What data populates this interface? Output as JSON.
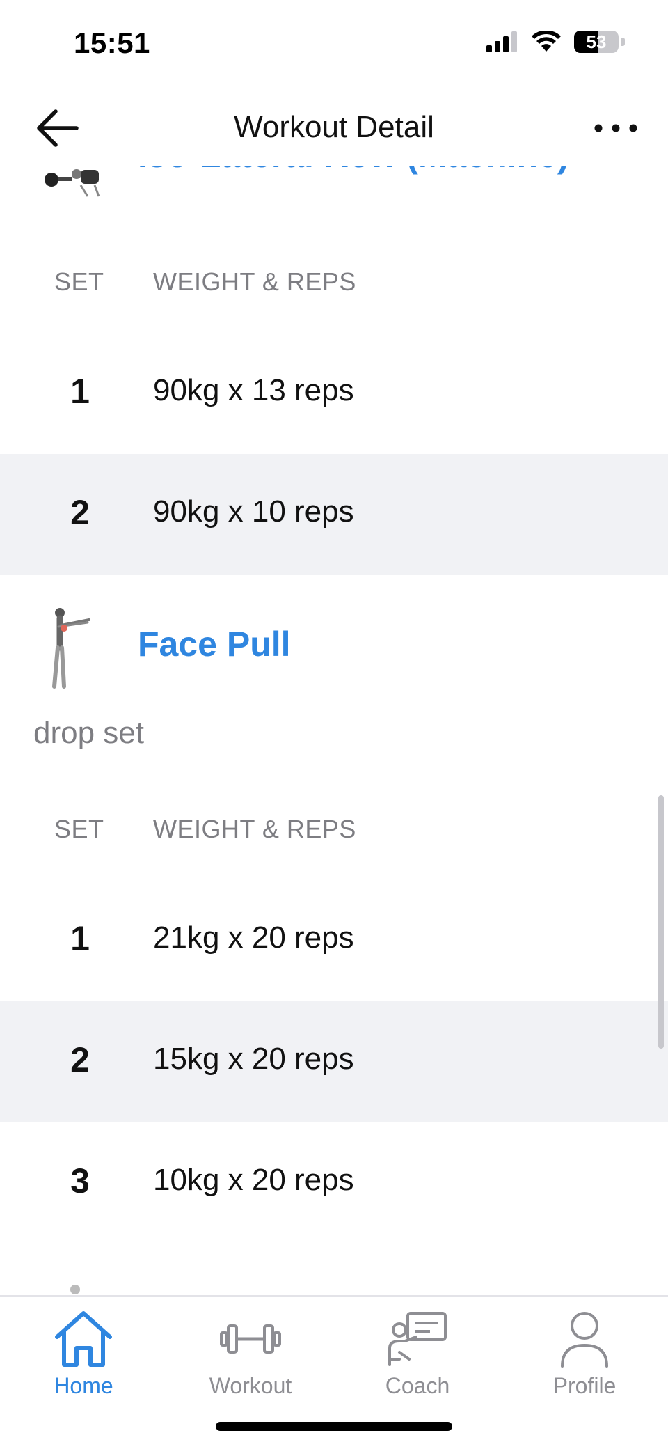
{
  "status": {
    "time": "15:51",
    "battery": "53"
  },
  "nav": {
    "title": "Workout Detail"
  },
  "exercises": [
    {
      "title": "Iso-Lateral Row (Machine)",
      "set_header": "SET",
      "value_header": "WEIGHT & REPS",
      "sets": [
        {
          "num": "1",
          "value": "90kg x 13 reps"
        },
        {
          "num": "2",
          "value": "90kg x 10 reps"
        }
      ]
    },
    {
      "title": "Face Pull",
      "note": "drop set",
      "set_header": "SET",
      "value_header": "WEIGHT & REPS",
      "sets": [
        {
          "num": "1",
          "value": "21kg x 20 reps"
        },
        {
          "num": "2",
          "value": "15kg x 20 reps"
        },
        {
          "num": "3",
          "value": "10kg x 20 reps"
        }
      ]
    }
  ],
  "tabs": [
    {
      "label": "Home",
      "icon": "home-icon",
      "active": true
    },
    {
      "label": "Workout",
      "icon": "dumbbell-icon",
      "active": false
    },
    {
      "label": "Coach",
      "icon": "coach-icon",
      "active": false
    },
    {
      "label": "Profile",
      "icon": "profile-icon",
      "active": false
    }
  ],
  "colors": {
    "accent": "#2f86e0",
    "row_alt": "#f1f2f5",
    "muted": "#7d7d82"
  }
}
